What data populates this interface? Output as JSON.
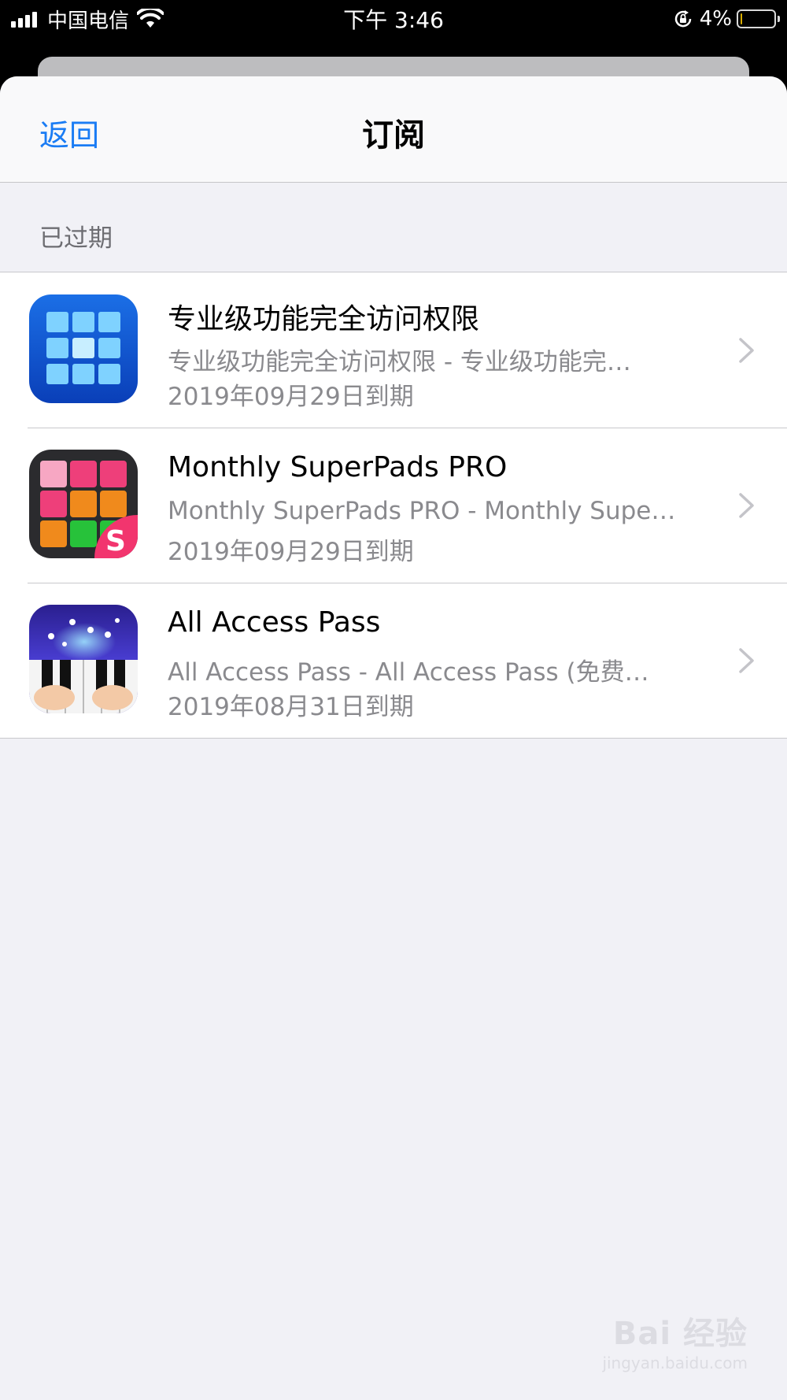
{
  "status_bar": {
    "carrier": "中国电信",
    "time": "下午 3:46",
    "battery_percent": "4%",
    "battery_level": 0.04,
    "icons": [
      "signal-icon",
      "wifi-icon",
      "rotation-lock-icon",
      "battery-icon"
    ]
  },
  "nav": {
    "back_label": "返回",
    "title": "订阅"
  },
  "section": {
    "header": "已过期"
  },
  "subscriptions": [
    {
      "title": "专业级功能完全访问权限",
      "subtitle": "专业级功能完全访问权限 - 专业级功能完…",
      "expiry": "2019年09月29日到期",
      "icon": "blue-grid-app-icon"
    },
    {
      "title": "Monthly SuperPads PRO",
      "subtitle": "Monthly SuperPads PRO - Monthly Supe…",
      "expiry": "2019年09月29日到期",
      "icon": "superpads-app-icon",
      "badge_text": "S"
    },
    {
      "title": "All Access Pass",
      "subtitle": "All Access Pass - All Access Pass (免费…",
      "expiry": "2019年08月31日到期",
      "icon": "piano-app-icon"
    }
  ],
  "watermark": {
    "main": "Bai 经验",
    "sub": "jingyan.baidu.com"
  },
  "colors": {
    "accent": "#1a7cf4",
    "background": "#f1f1f6",
    "secondary_text": "#8a8a8e"
  }
}
